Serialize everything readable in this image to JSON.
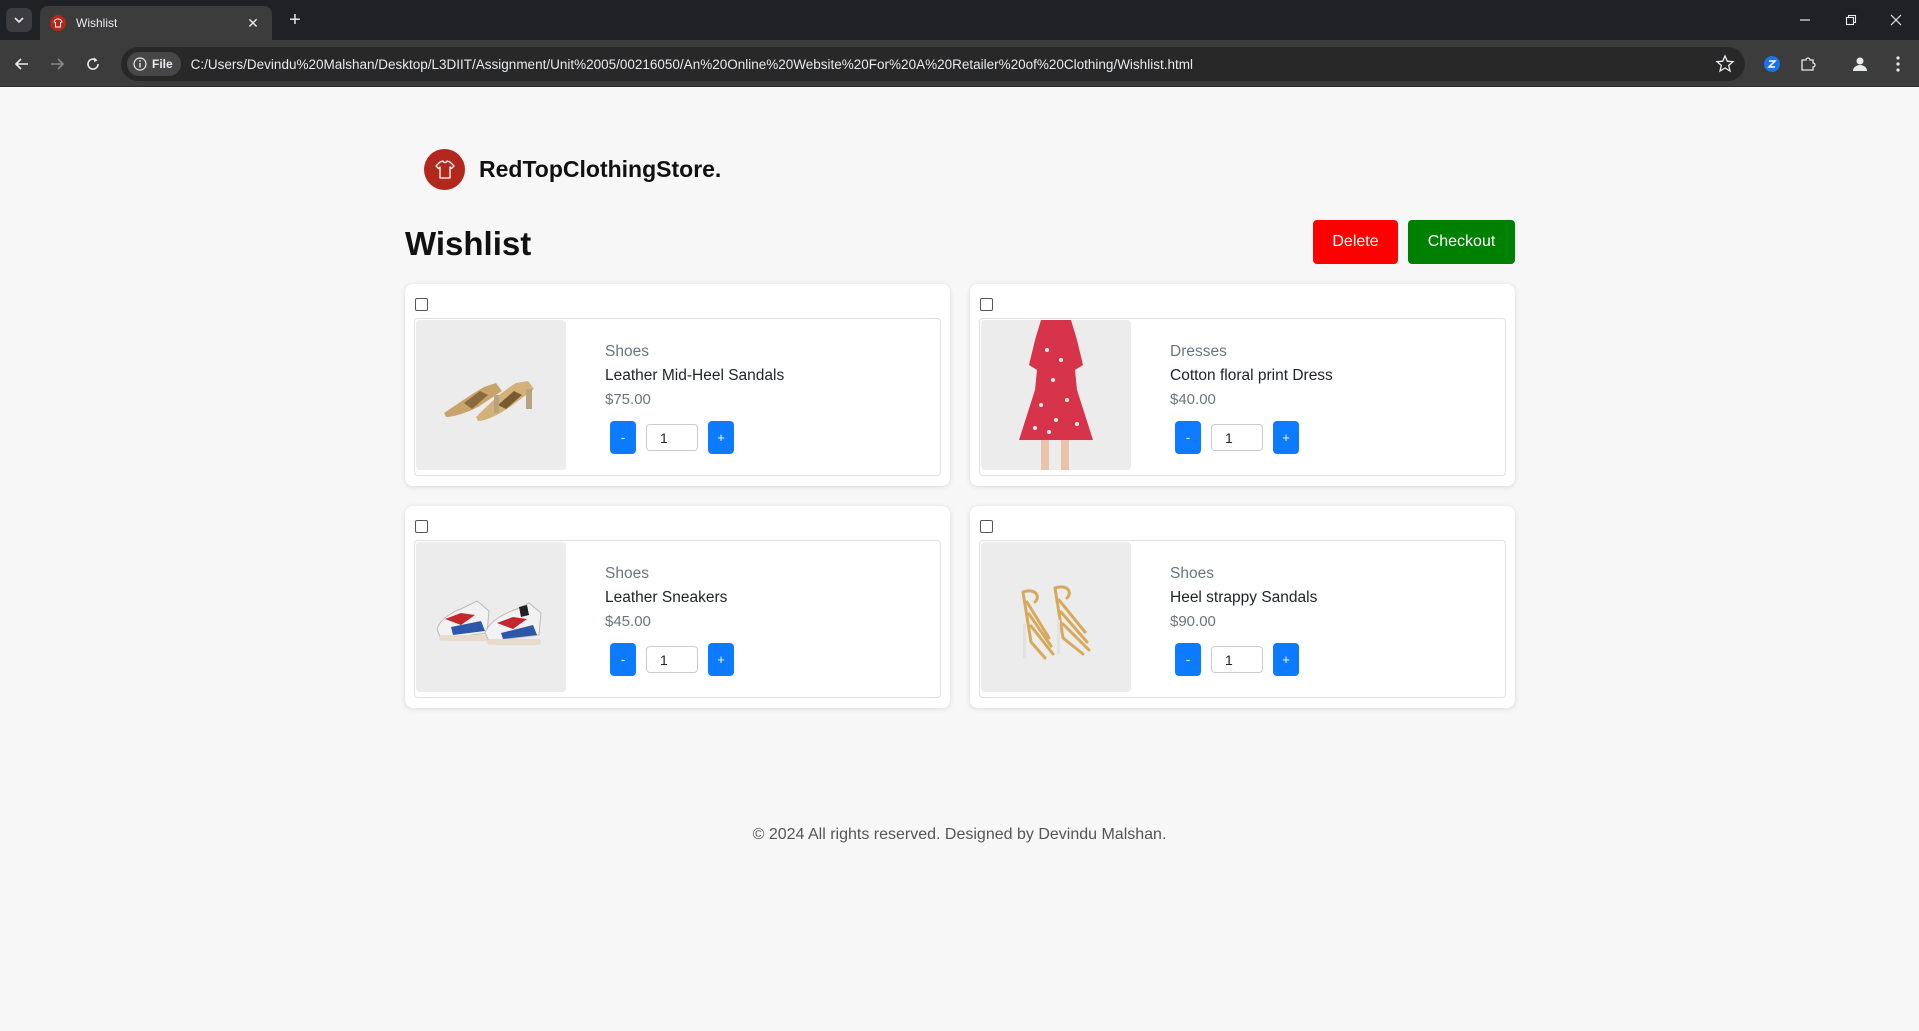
{
  "browser": {
    "tab_title": "Wishlist",
    "new_tab_symbol": "+",
    "close_symbol": "✕",
    "address_chip": "File",
    "url": "C:/Users/Devindu%20Malshan/Desktop/L3DIIT/Assignment/Unit%2005/00216050/An%20Online%20Website%20For%20A%20Retailer%20of%20Clothing/Wishlist.html"
  },
  "brand": {
    "name": "RedTopClothingStore."
  },
  "page": {
    "title": "Wishlist",
    "delete_label": "Delete",
    "checkout_label": "Checkout"
  },
  "items": [
    {
      "category": "Shoes",
      "name": "Leather Mid-Heel Sandals",
      "price": "$75.00",
      "qty": "1",
      "minus": "-",
      "plus": "+",
      "image": "snakeskin-sandal-icon"
    },
    {
      "category": "Dresses",
      "name": "Cotton floral print Dress",
      "price": "$40.00",
      "qty": "1",
      "minus": "-",
      "plus": "+",
      "image": "floral-dress-icon"
    },
    {
      "category": "Shoes",
      "name": "Leather Sneakers",
      "price": "$45.00",
      "qty": "1",
      "minus": "-",
      "plus": "+",
      "image": "sneaker-icon"
    },
    {
      "category": "Shoes",
      "name": "Heel strappy Sandals",
      "price": "$90.00",
      "qty": "1",
      "minus": "-",
      "plus": "+",
      "image": "strappy-heel-icon"
    }
  ],
  "footer": {
    "text": "© 2024 All rights reserved. Designed by Devindu Malshan."
  },
  "colors": {
    "delete": "#ff0000",
    "checkout": "#008000",
    "qty_button": "#0d7bff",
    "logo": "#b3281d"
  }
}
